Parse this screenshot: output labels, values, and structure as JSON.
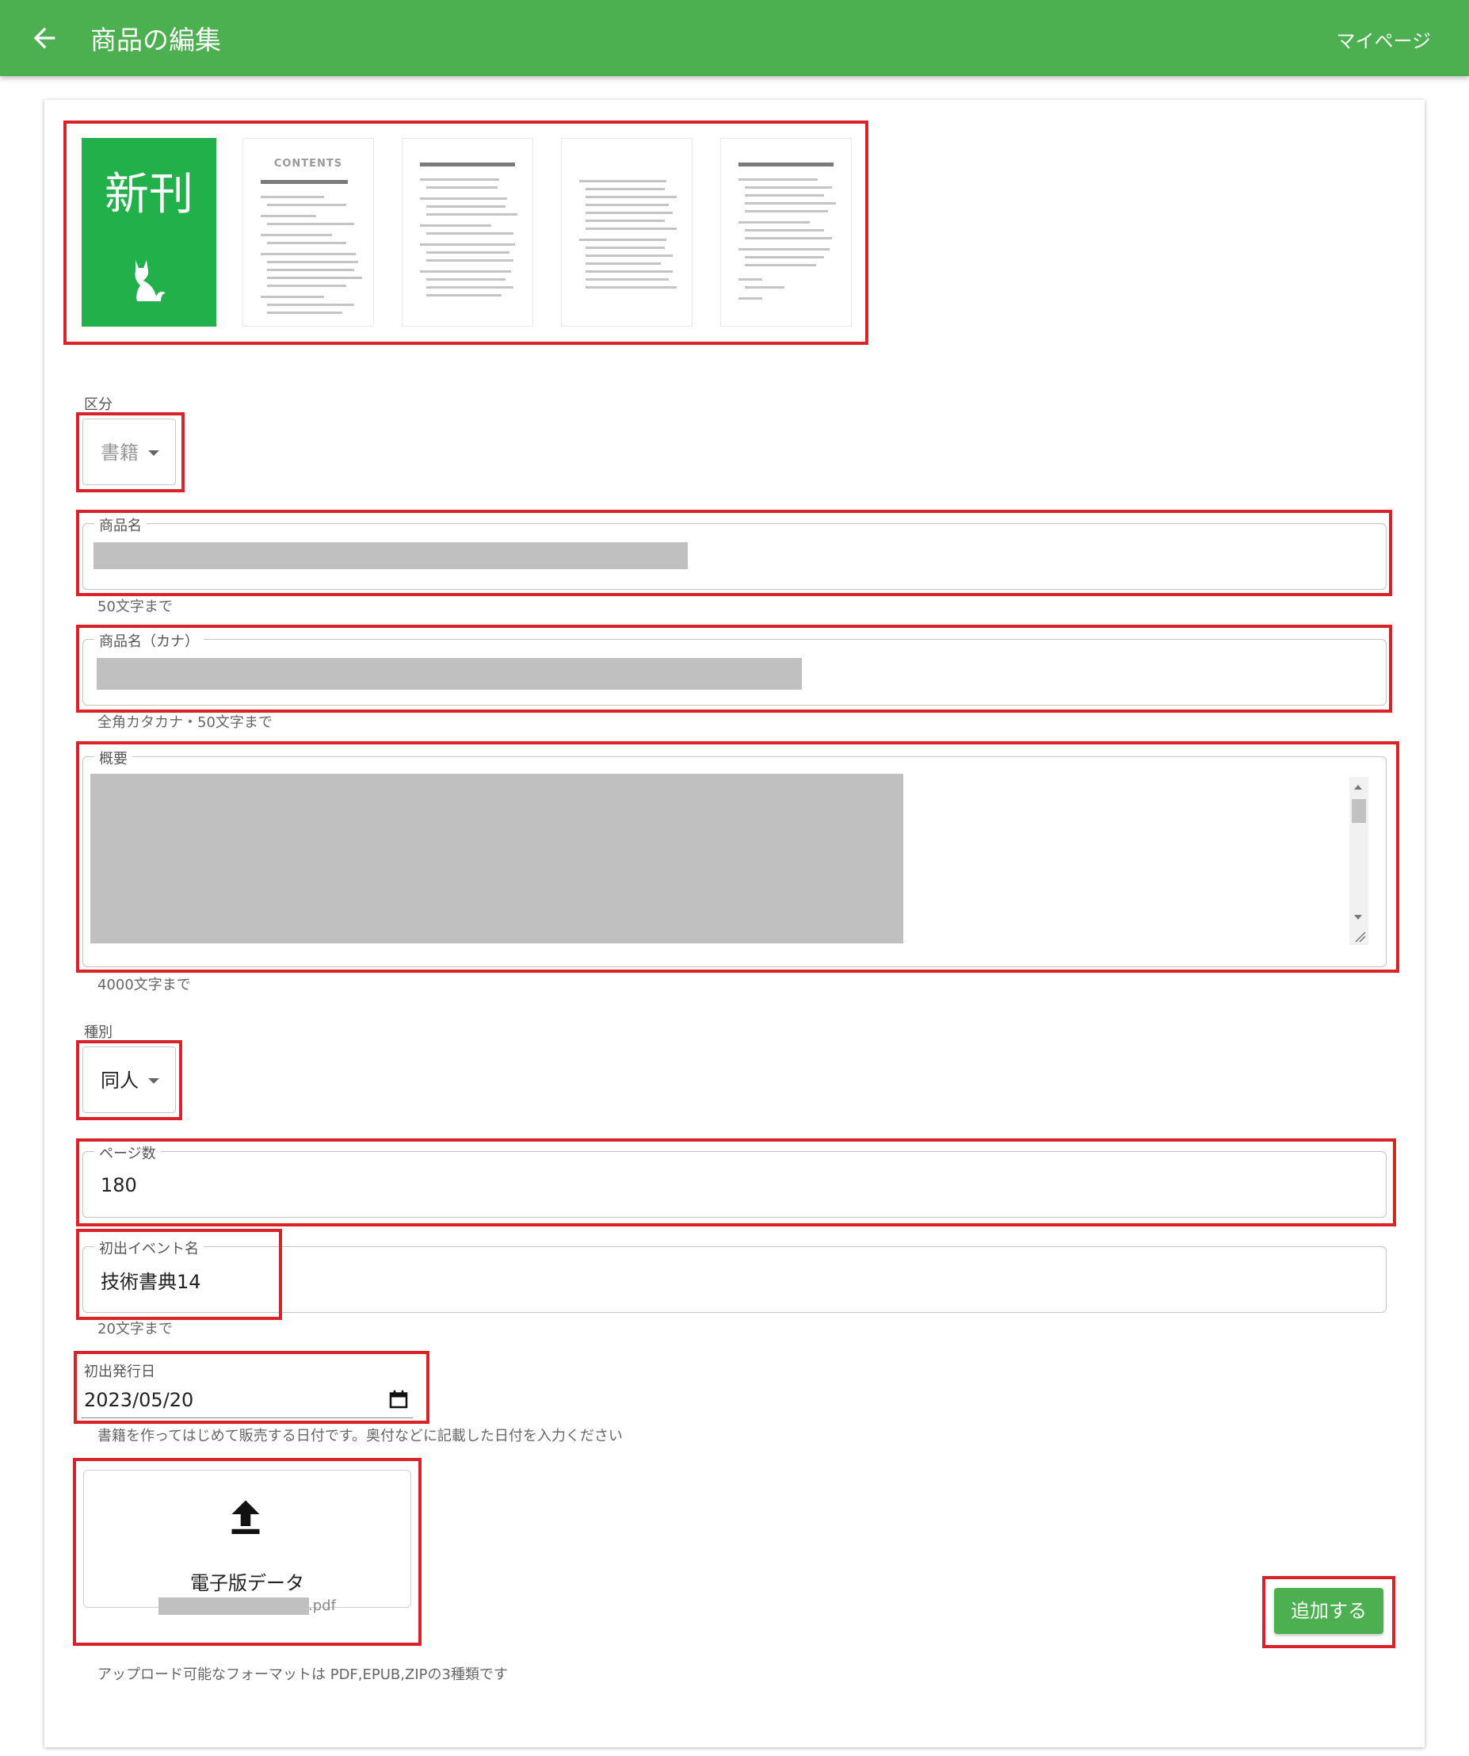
{
  "appbar": {
    "title": "商品の編集",
    "mypage_link": "マイページ",
    "back_icon": "arrow-left-icon"
  },
  "cover": {
    "new_badge": "新刊",
    "contents_heading": "CONTENTS"
  },
  "category": {
    "label": "区分",
    "value": "書籍"
  },
  "product_name": {
    "label": "商品名",
    "value": "",
    "help": "50文字まで"
  },
  "product_name_kana": {
    "label": "商品名（カナ）",
    "value": "",
    "help": "全角カタカナ・50文字まで"
  },
  "summary": {
    "label": "概要",
    "value": "",
    "help": "4000文字まで"
  },
  "type": {
    "label": "種別",
    "value": "同人"
  },
  "pages": {
    "label": "ページ数",
    "value": "180"
  },
  "first_event": {
    "label": "初出イベント名",
    "value": "技術書典14",
    "help": "20文字まで"
  },
  "first_date": {
    "label": "初出発行日",
    "value": "2023/05/20",
    "help": "書籍を作ってはじめて販売する日付です。奥付などに記載した日付を入力ください"
  },
  "upload": {
    "title": "電子版データ",
    "file_ext": ".pdf",
    "help": "アップロード可能なフォーマットは PDF,EPUB,ZIPの3種類です",
    "icon": "upload-icon"
  },
  "submit_label": "追加する",
  "colors": {
    "primary": "#4caf50",
    "cover_green": "#22b04b",
    "highlight": "#d9222a"
  }
}
